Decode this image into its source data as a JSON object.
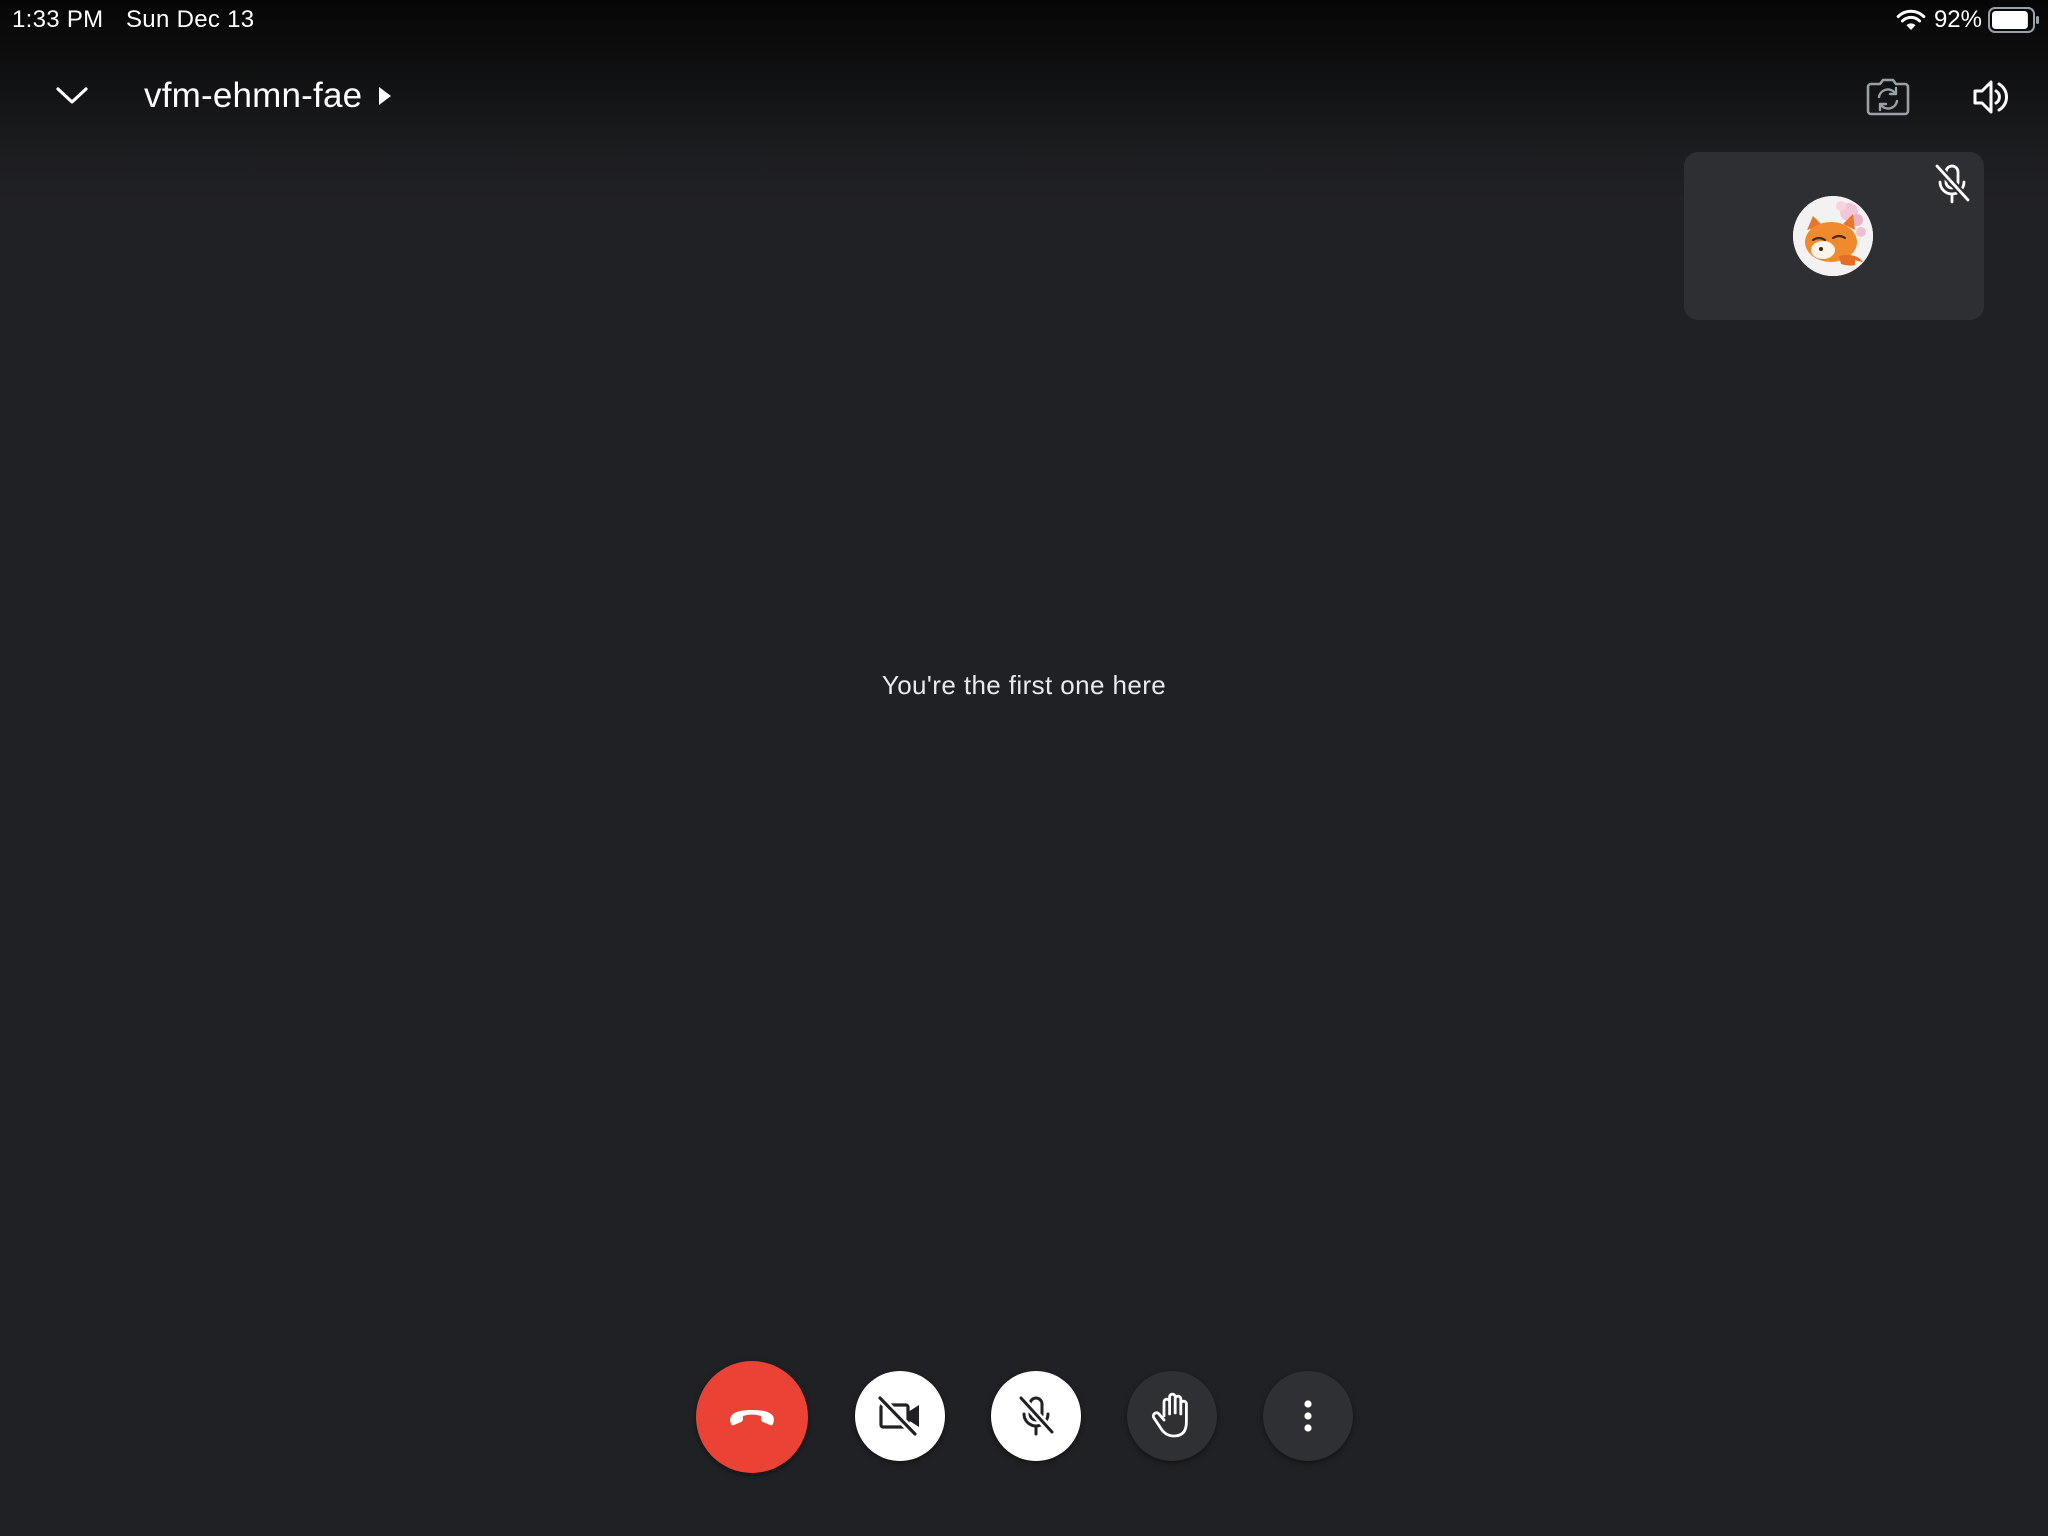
{
  "status_bar": {
    "time": "1:33 PM",
    "date": "Sun Dec 13",
    "battery_percent": "92%",
    "battery_level": 0.92
  },
  "header": {
    "meeting_code": "vfm-ehmn-fae",
    "icons": {
      "collapse": "chevron-down-icon",
      "details": "caret-right-icon",
      "switch_camera": "switch-camera-icon",
      "speaker": "speaker-icon"
    }
  },
  "self_tile": {
    "mic_state_icon": "mic-off-icon",
    "avatar": "fox-avatar"
  },
  "main": {
    "message": "You're the first one here"
  },
  "controls": {
    "end_call": {
      "icon": "phone-hangup-icon",
      "color": "#ea4335"
    },
    "camera": {
      "icon": "camera-off-icon",
      "state": "off"
    },
    "microphone": {
      "icon": "mic-off-icon",
      "state": "off"
    },
    "raise_hand": {
      "icon": "hand-icon"
    },
    "more": {
      "icon": "more-vertical-icon"
    }
  },
  "colors": {
    "background": "#202124",
    "tile": "#2e2f32",
    "end_call": "#ea4335",
    "text": "#ffffff"
  }
}
